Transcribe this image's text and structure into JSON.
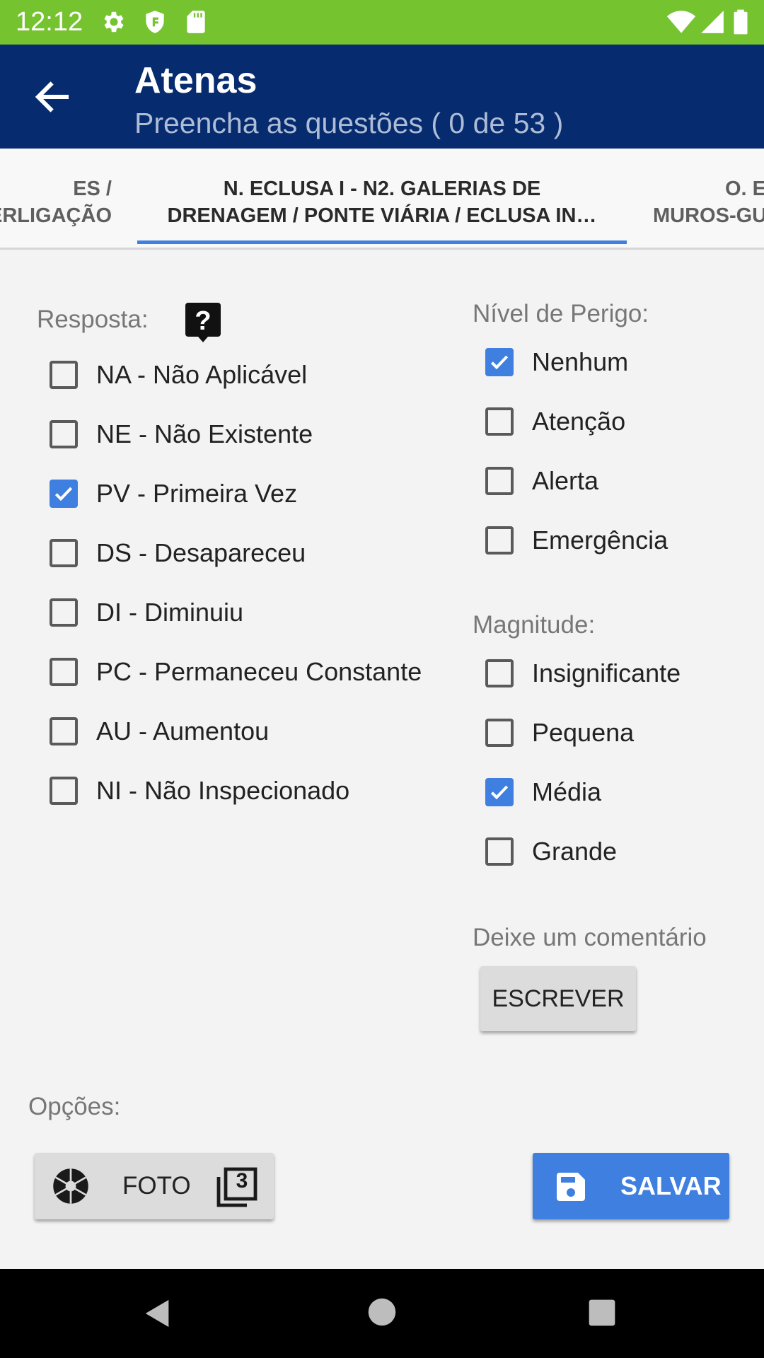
{
  "status_bar": {
    "time": "12:12",
    "icons": [
      "gear-icon",
      "shield-icon",
      "sd-card-icon",
      "wifi-icon",
      "signal-icon",
      "battery-icon"
    ]
  },
  "app_bar": {
    "title": "Atenas",
    "subtitle": "Preencha as questões ( 0 de 53 )",
    "back_icon": "arrow-left-icon"
  },
  "tabs": [
    {
      "line1": "ES /",
      "line2": "ERLIGAÇÃO"
    },
    {
      "line1": "N. ECLUSA I - N2. GALERIAS DE",
      "line2": "DRENAGEM / PONTE VIÁRIA / ECLUSA IN…",
      "active": true
    },
    {
      "line1": "O. E",
      "line2": "MUROS-GU"
    }
  ],
  "resposta": {
    "label": "Resposta:",
    "help_icon": "help-icon",
    "options": [
      {
        "label": "NA - Não Aplicável",
        "checked": false
      },
      {
        "label": "NE - Não Existente",
        "checked": false
      },
      {
        "label": "PV - Primeira Vez",
        "checked": true
      },
      {
        "label": "DS - Desapareceu",
        "checked": false
      },
      {
        "label": "DI - Diminuiu",
        "checked": false
      },
      {
        "label": "PC - Permaneceu Constante",
        "checked": false
      },
      {
        "label": "AU - Aumentou",
        "checked": false
      },
      {
        "label": "NI - Não Inspecionado",
        "checked": false
      }
    ]
  },
  "perigo": {
    "label": "Nível de Perigo:",
    "options": [
      {
        "label": "Nenhum",
        "checked": true
      },
      {
        "label": "Atenção",
        "checked": false
      },
      {
        "label": "Alerta",
        "checked": false
      },
      {
        "label": "Emergência",
        "checked": false
      }
    ]
  },
  "magnitude": {
    "label": "Magnitude:",
    "options": [
      {
        "label": "Insignificante",
        "checked": false
      },
      {
        "label": "Pequena",
        "checked": false
      },
      {
        "label": "Média",
        "checked": true
      },
      {
        "label": "Grande",
        "checked": false
      }
    ]
  },
  "comentario": {
    "label": "Deixe um comentário",
    "button": "ESCREVER"
  },
  "opcoes": {
    "label": "Opções:",
    "foto_button": "FOTO",
    "photo_count": "3",
    "salvar_button": "SALVAR"
  },
  "colors": {
    "status_bar": "#74c32f",
    "app_bar": "#062b6e",
    "accent": "#3f7fe0"
  }
}
